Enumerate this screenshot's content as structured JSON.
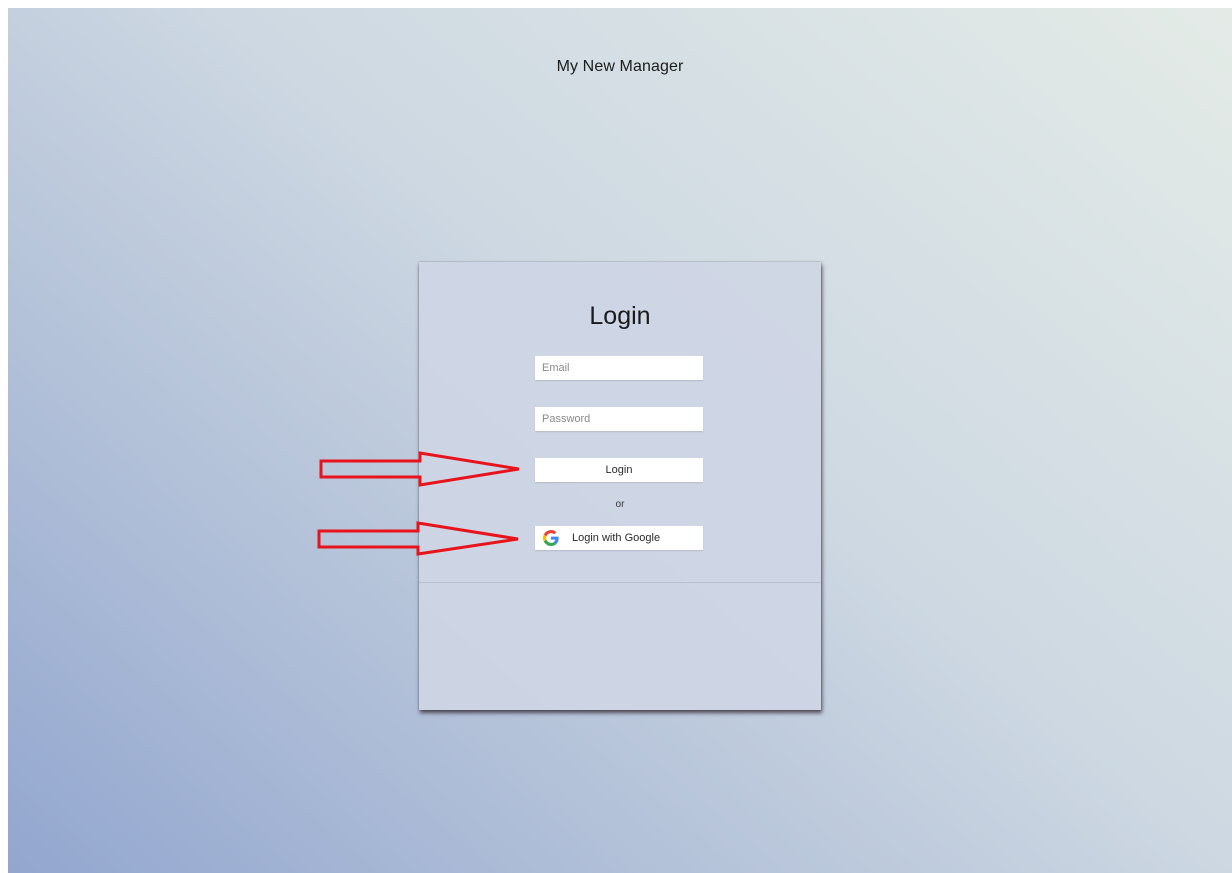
{
  "app": {
    "title": "My New Manager"
  },
  "login_card": {
    "heading": "Login",
    "email": {
      "placeholder": "Email",
      "value": ""
    },
    "password": {
      "placeholder": "Password",
      "value": ""
    },
    "login_button_label": "Login",
    "separator_text": "or",
    "google_button_label": "Login with Google",
    "google_icon": "google-g-logo"
  },
  "colors": {
    "annotation_arrow": "#e8141c",
    "google_blue": "#4285f4",
    "google_red": "#ea4335",
    "google_yellow": "#fbbc05",
    "google_green": "#34a853"
  }
}
